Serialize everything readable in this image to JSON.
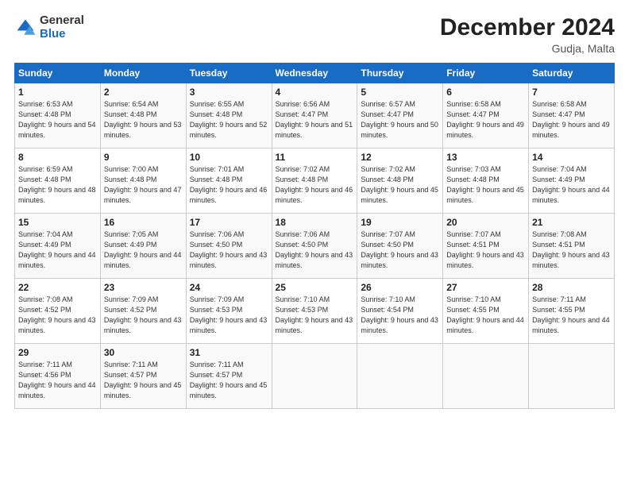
{
  "logo": {
    "general": "General",
    "blue": "Blue"
  },
  "title": "December 2024",
  "location": "Gudja, Malta",
  "days_of_week": [
    "Sunday",
    "Monday",
    "Tuesday",
    "Wednesday",
    "Thursday",
    "Friday",
    "Saturday"
  ],
  "weeks": [
    [
      {
        "day": "1",
        "sunrise": "6:53 AM",
        "sunset": "4:48 PM",
        "daylight": "9 hours and 54 minutes."
      },
      {
        "day": "2",
        "sunrise": "6:54 AM",
        "sunset": "4:48 PM",
        "daylight": "9 hours and 53 minutes."
      },
      {
        "day": "3",
        "sunrise": "6:55 AM",
        "sunset": "4:48 PM",
        "daylight": "9 hours and 52 minutes."
      },
      {
        "day": "4",
        "sunrise": "6:56 AM",
        "sunset": "4:47 PM",
        "daylight": "9 hours and 51 minutes."
      },
      {
        "day": "5",
        "sunrise": "6:57 AM",
        "sunset": "4:47 PM",
        "daylight": "9 hours and 50 minutes."
      },
      {
        "day": "6",
        "sunrise": "6:58 AM",
        "sunset": "4:47 PM",
        "daylight": "9 hours and 49 minutes."
      },
      {
        "day": "7",
        "sunrise": "6:58 AM",
        "sunset": "4:47 PM",
        "daylight": "9 hours and 49 minutes."
      }
    ],
    [
      {
        "day": "8",
        "sunrise": "6:59 AM",
        "sunset": "4:48 PM",
        "daylight": "9 hours and 48 minutes."
      },
      {
        "day": "9",
        "sunrise": "7:00 AM",
        "sunset": "4:48 PM",
        "daylight": "9 hours and 47 minutes."
      },
      {
        "day": "10",
        "sunrise": "7:01 AM",
        "sunset": "4:48 PM",
        "daylight": "9 hours and 46 minutes."
      },
      {
        "day": "11",
        "sunrise": "7:02 AM",
        "sunset": "4:48 PM",
        "daylight": "9 hours and 46 minutes."
      },
      {
        "day": "12",
        "sunrise": "7:02 AM",
        "sunset": "4:48 PM",
        "daylight": "9 hours and 45 minutes."
      },
      {
        "day": "13",
        "sunrise": "7:03 AM",
        "sunset": "4:48 PM",
        "daylight": "9 hours and 45 minutes."
      },
      {
        "day": "14",
        "sunrise": "7:04 AM",
        "sunset": "4:49 PM",
        "daylight": "9 hours and 44 minutes."
      }
    ],
    [
      {
        "day": "15",
        "sunrise": "7:04 AM",
        "sunset": "4:49 PM",
        "daylight": "9 hours and 44 minutes."
      },
      {
        "day": "16",
        "sunrise": "7:05 AM",
        "sunset": "4:49 PM",
        "daylight": "9 hours and 44 minutes."
      },
      {
        "day": "17",
        "sunrise": "7:06 AM",
        "sunset": "4:50 PM",
        "daylight": "9 hours and 43 minutes."
      },
      {
        "day": "18",
        "sunrise": "7:06 AM",
        "sunset": "4:50 PM",
        "daylight": "9 hours and 43 minutes."
      },
      {
        "day": "19",
        "sunrise": "7:07 AM",
        "sunset": "4:50 PM",
        "daylight": "9 hours and 43 minutes."
      },
      {
        "day": "20",
        "sunrise": "7:07 AM",
        "sunset": "4:51 PM",
        "daylight": "9 hours and 43 minutes."
      },
      {
        "day": "21",
        "sunrise": "7:08 AM",
        "sunset": "4:51 PM",
        "daylight": "9 hours and 43 minutes."
      }
    ],
    [
      {
        "day": "22",
        "sunrise": "7:08 AM",
        "sunset": "4:52 PM",
        "daylight": "9 hours and 43 minutes."
      },
      {
        "day": "23",
        "sunrise": "7:09 AM",
        "sunset": "4:52 PM",
        "daylight": "9 hours and 43 minutes."
      },
      {
        "day": "24",
        "sunrise": "7:09 AM",
        "sunset": "4:53 PM",
        "daylight": "9 hours and 43 minutes."
      },
      {
        "day": "25",
        "sunrise": "7:10 AM",
        "sunset": "4:53 PM",
        "daylight": "9 hours and 43 minutes."
      },
      {
        "day": "26",
        "sunrise": "7:10 AM",
        "sunset": "4:54 PM",
        "daylight": "9 hours and 43 minutes."
      },
      {
        "day": "27",
        "sunrise": "7:10 AM",
        "sunset": "4:55 PM",
        "daylight": "9 hours and 44 minutes."
      },
      {
        "day": "28",
        "sunrise": "7:11 AM",
        "sunset": "4:55 PM",
        "daylight": "9 hours and 44 minutes."
      }
    ],
    [
      {
        "day": "29",
        "sunrise": "7:11 AM",
        "sunset": "4:56 PM",
        "daylight": "9 hours and 44 minutes."
      },
      {
        "day": "30",
        "sunrise": "7:11 AM",
        "sunset": "4:57 PM",
        "daylight": "9 hours and 45 minutes."
      },
      {
        "day": "31",
        "sunrise": "7:11 AM",
        "sunset": "4:57 PM",
        "daylight": "9 hours and 45 minutes."
      },
      null,
      null,
      null,
      null
    ]
  ]
}
